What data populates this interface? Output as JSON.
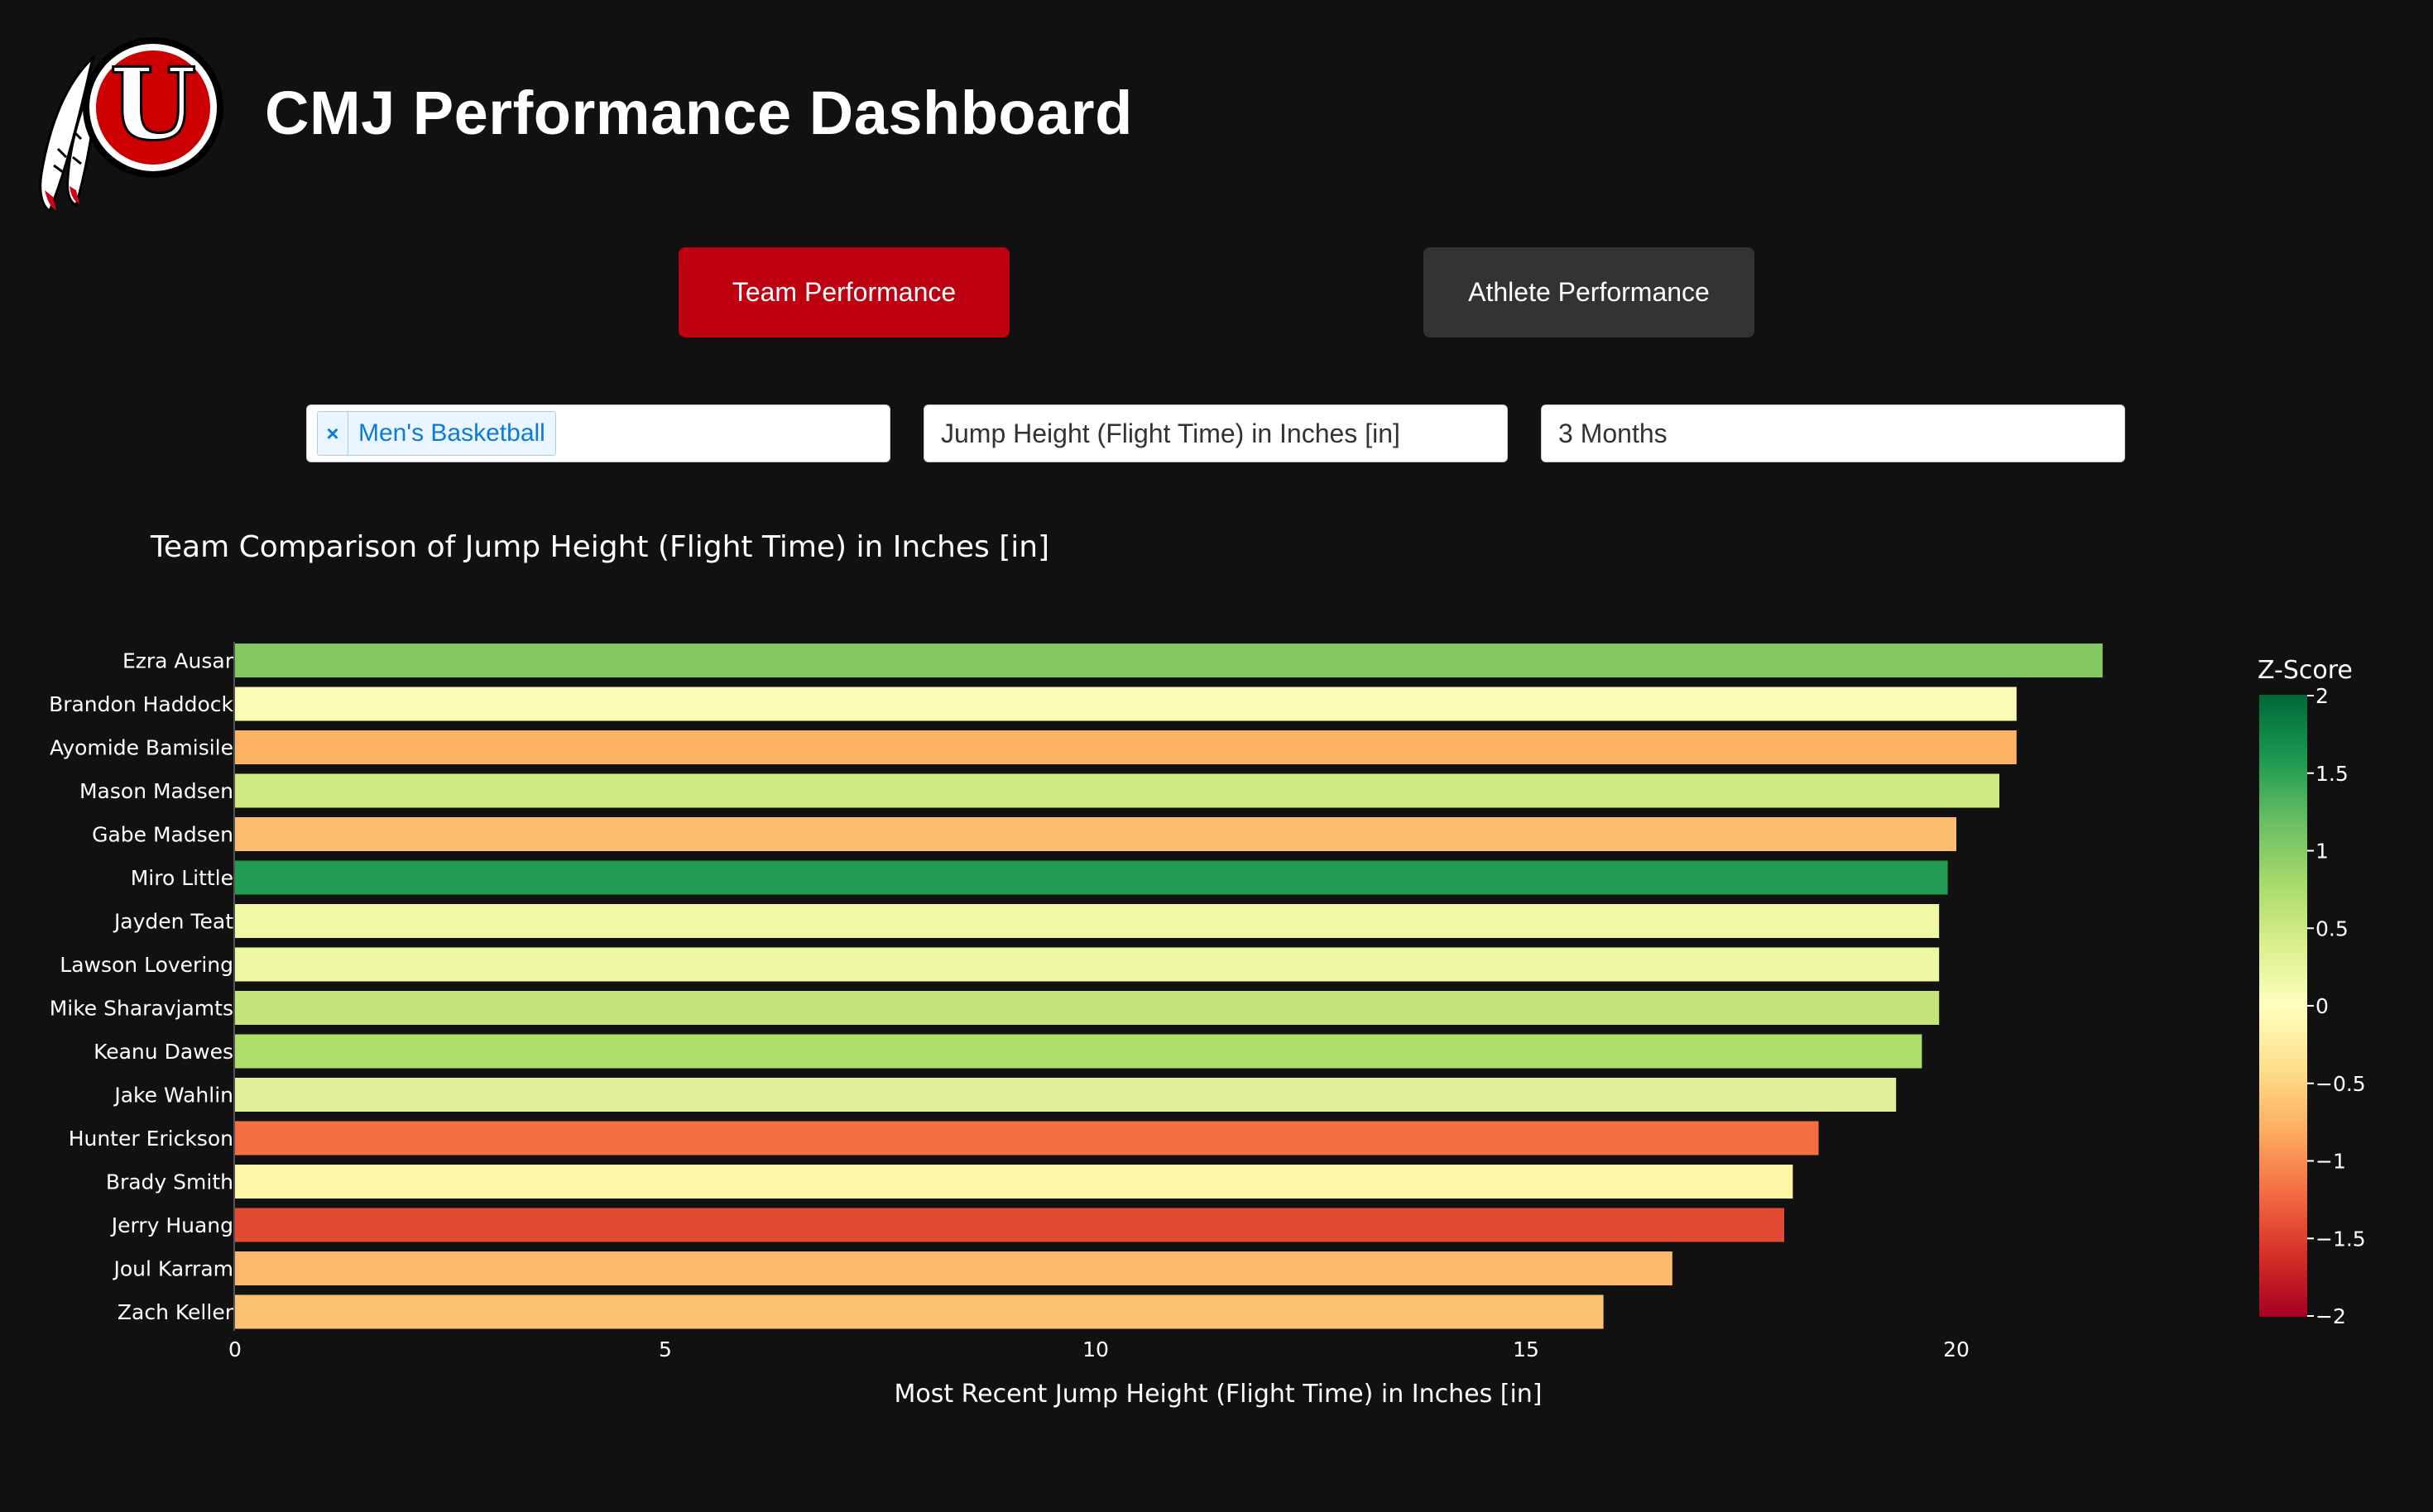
{
  "header": {
    "title": "CMJ Performance Dashboard",
    "logo_icon": "utah-utes-drum-and-feathers-logo",
    "logo_letter": "U"
  },
  "nav": {
    "team_label": "Team Performance",
    "athlete_label": "Athlete Performance",
    "active": "team"
  },
  "filters": {
    "team": {
      "selected": "Men's Basketball",
      "remove_icon": "×"
    },
    "metric": {
      "value": "Jump Height (Flight Time) in Inches [in]"
    },
    "range": {
      "value": "3 Months"
    }
  },
  "colors": {
    "background": "#111111",
    "primary_red": "#bf0010",
    "secondary_button": "#333333"
  },
  "chart_data": {
    "type": "bar",
    "orientation": "horizontal",
    "title": "Team Comparison of Jump Height (Flight Time) in Inches [in]",
    "xlabel": "Most Recent Jump Height (Flight Time) in Inches [in]",
    "ylabel": "",
    "xlim": [
      0,
      22.8
    ],
    "xticks": [
      0,
      5,
      10,
      15,
      20
    ],
    "grid": false,
    "colorscale": "RdYlGn",
    "colorbar": {
      "title": "Z-Score",
      "range": [
        -2,
        2
      ],
      "ticks": [
        "2",
        "1.5",
        "1",
        "0.5",
        "0",
        "−0.5",
        "−1",
        "−1.5",
        "−2"
      ]
    },
    "categories": [
      "Ezra Ausar",
      "Brandon Haddock",
      "Ayomide Bamisile",
      "Mason Madsen",
      "Gabe Madsen",
      "Miro Little",
      "Jayden Teat",
      "Lawson Lovering",
      "Mike Sharavjamts",
      "Keanu Dawes",
      "Jake Wahlin",
      "Hunter Erickson",
      "Brady Smith",
      "Jerry Huang",
      "Joul Karram",
      "Zach Keller"
    ],
    "values": [
      21.7,
      20.7,
      20.7,
      20.5,
      20.0,
      19.9,
      19.8,
      19.8,
      19.8,
      19.6,
      19.3,
      18.4,
      18.1,
      18.0,
      16.7,
      15.9
    ],
    "colors": [
      "#84c864",
      "#fafcb4",
      "#fdb163",
      "#cfe980",
      "#fdbd6e",
      "#229c55",
      "#f0f8a4",
      "#eef7a2",
      "#c3e57a",
      "#aedd6c",
      "#e0f199",
      "#f46d43",
      "#fef7a7",
      "#e34a33",
      "#fdb96b",
      "#fdc271"
    ]
  }
}
